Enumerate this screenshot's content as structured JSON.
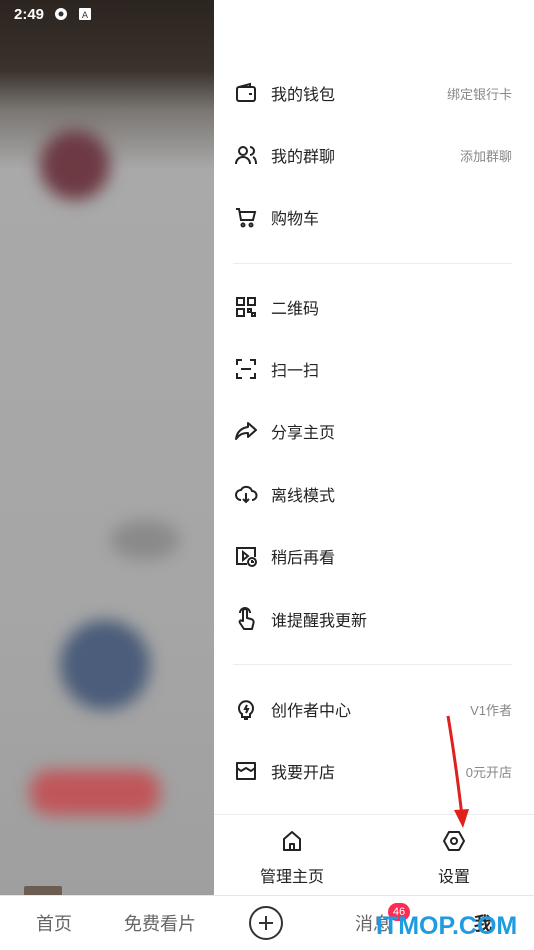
{
  "status_bar": {
    "time": "2:49"
  },
  "drawer": {
    "group1": [
      {
        "label": "我的钱包",
        "hint": "绑定银行卡",
        "icon": "wallet-icon"
      },
      {
        "label": "我的群聊",
        "hint": "添加群聊",
        "icon": "group-chat-icon"
      },
      {
        "label": "购物车",
        "hint": "",
        "icon": "cart-icon"
      }
    ],
    "group2": [
      {
        "label": "二维码",
        "icon": "qr-code-icon"
      },
      {
        "label": "扫一扫",
        "icon": "scan-icon"
      },
      {
        "label": "分享主页",
        "icon": "share-icon"
      },
      {
        "label": "离线模式",
        "icon": "offline-download-icon"
      },
      {
        "label": "稍后再看",
        "icon": "watch-later-icon"
      },
      {
        "label": "谁提醒我更新",
        "icon": "tap-hand-icon"
      }
    ],
    "group3": [
      {
        "label": "创作者中心",
        "hint": "V1作者",
        "icon": "lightbulb-icon"
      },
      {
        "label": "我要开店",
        "hint": "0元开店",
        "icon": "store-icon"
      }
    ],
    "footer": {
      "manage_label": "管理主页",
      "settings_label": "设置"
    }
  },
  "bottom_nav": {
    "home": "首页",
    "free_movies": "免费看片",
    "messages": "消息",
    "messages_badge": "46",
    "me": "我"
  },
  "watermark": "ITMOP.COM",
  "colors": {
    "badge": "#ff2b55",
    "watermark": "#1f9be2",
    "annotation_arrow": "#e0201b"
  }
}
